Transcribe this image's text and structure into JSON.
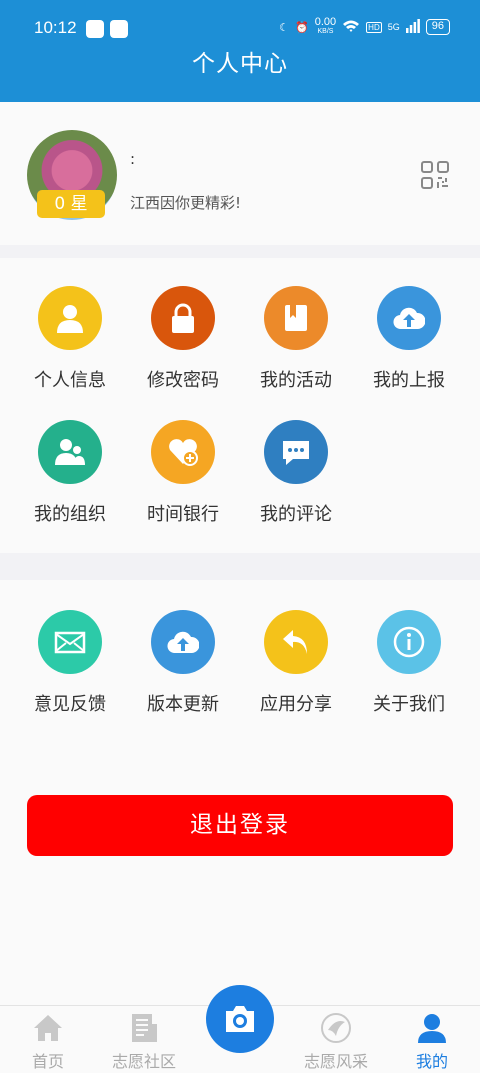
{
  "status_bar": {
    "time": "10:12",
    "speed": "0.00",
    "speed_unit": "KB/S",
    "hd": "HD",
    "net": "5G",
    "battery": "96"
  },
  "header": {
    "title": "个人中心"
  },
  "profile": {
    "nickname": ":",
    "star_badge": "0 星",
    "slogan": "江西因你更精彩!"
  },
  "menu_main": [
    {
      "label": "个人信息",
      "icon": "person-icon",
      "color": "#f4c21a"
    },
    {
      "label": "修改密码",
      "icon": "lock-icon",
      "color": "#d9560c"
    },
    {
      "label": "我的活动",
      "icon": "book-icon",
      "color": "#ec8a2a"
    },
    {
      "label": "我的上报",
      "icon": "cloud-upload-icon",
      "color": "#3a95dc"
    },
    {
      "label": "我的组织",
      "icon": "group-icon",
      "color": "#24b08c"
    },
    {
      "label": "时间银行",
      "icon": "heart-plus-icon",
      "color": "#f5a623"
    },
    {
      "label": "我的评论",
      "icon": "chat-icon",
      "color": "#2f7fc1"
    }
  ],
  "menu_other": [
    {
      "label": "意见反馈",
      "icon": "mail-icon",
      "color": "#2ccaa8"
    },
    {
      "label": "版本更新",
      "icon": "cloud-upload-icon",
      "color": "#3a95dc"
    },
    {
      "label": "应用分享",
      "icon": "share-arrow-icon",
      "color": "#f4c21a"
    },
    {
      "label": "关于我们",
      "icon": "info-icon",
      "color": "#5bc2e7"
    }
  ],
  "logout_label": "退出登录",
  "tabs": [
    {
      "label": "首页",
      "icon": "home-icon"
    },
    {
      "label": "志愿社区",
      "icon": "news-icon"
    },
    {
      "label": "志愿风采",
      "icon": "emblem-icon"
    },
    {
      "label": "我的",
      "icon": "user-icon"
    }
  ],
  "colors": {
    "primary": "#1d8fd6",
    "logout": "#ff0000",
    "active_tab": "#1d7ee0"
  }
}
